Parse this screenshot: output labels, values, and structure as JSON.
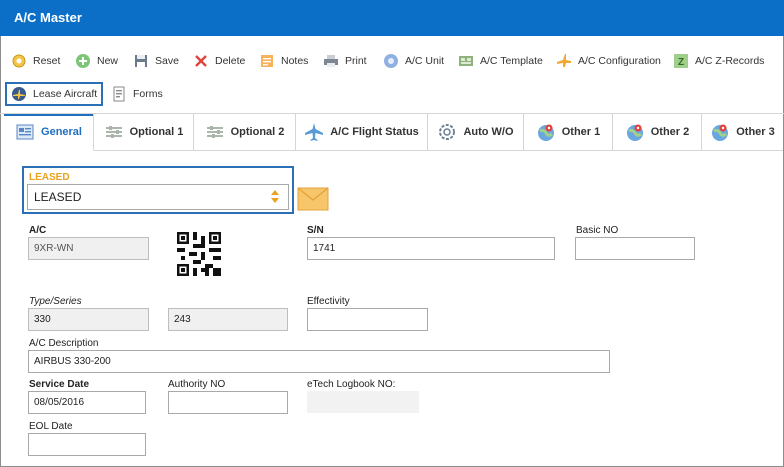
{
  "window": {
    "title": "A/C Master"
  },
  "toolbar": {
    "items": [
      {
        "label": "Reset",
        "icon": "reset-icon"
      },
      {
        "label": "New",
        "icon": "add-icon"
      },
      {
        "label": "Save",
        "icon": "floppy-icon"
      },
      {
        "label": "Delete",
        "icon": "close-icon"
      },
      {
        "label": "Notes",
        "icon": "note-icon"
      },
      {
        "label": "Print",
        "icon": "printer-icon"
      },
      {
        "label": "A/C Unit",
        "icon": "gear-icon"
      },
      {
        "label": "A/C Template",
        "icon": "template-icon"
      },
      {
        "label": "A/C Configuration",
        "icon": "airplane-config-icon"
      },
      {
        "label": "A/C Z-Records",
        "icon": "z-records-icon"
      },
      {
        "label": "Lease Aircraft",
        "icon": "airplane-lease-icon"
      },
      {
        "label": "Forms",
        "icon": "forms-icon"
      }
    ]
  },
  "tabs": [
    {
      "label": "General",
      "icon": "form-icon",
      "active": true
    },
    {
      "label": "Optional 1",
      "icon": "sliders-icon"
    },
    {
      "label": "Optional 2",
      "icon": "sliders-icon"
    },
    {
      "label": "A/C Flight Status",
      "icon": "airplane-icon"
    },
    {
      "label": "Auto W/O",
      "icon": "cog-icon"
    },
    {
      "label": "Other 1",
      "icon": "globe-pin-icon"
    },
    {
      "label": "Other 2",
      "icon": "globe-pin-icon"
    },
    {
      "label": "Other 3",
      "icon": "globe-pin-icon"
    }
  ],
  "form": {
    "leased": {
      "label": "LEASED",
      "value": "LEASED"
    },
    "ac": {
      "label": "A/C",
      "value": "9XR-WN"
    },
    "sn": {
      "label": "S/N",
      "value": "1741"
    },
    "basic_no": {
      "label": "Basic NO",
      "value": ""
    },
    "type_series": {
      "label": "Type/Series",
      "type": "330",
      "series": "243"
    },
    "effectivity": {
      "label": "Effectivity",
      "value": ""
    },
    "ac_description": {
      "label": "A/C Description",
      "value": "AIRBUS 330-200"
    },
    "service_date": {
      "label": "Service Date",
      "value": "08/05/2016"
    },
    "authority_no": {
      "label": "Authority NO",
      "value": ""
    },
    "etech_logbook": {
      "label": "eTech Logbook NO:",
      "value": ""
    },
    "eol_date": {
      "label": "EOL Date",
      "value": ""
    }
  },
  "colors": {
    "titlebar": "#0b6fc7",
    "accent": "#1e6fc0",
    "highlight": "#2b6fb7",
    "required": "#e8a21f"
  }
}
